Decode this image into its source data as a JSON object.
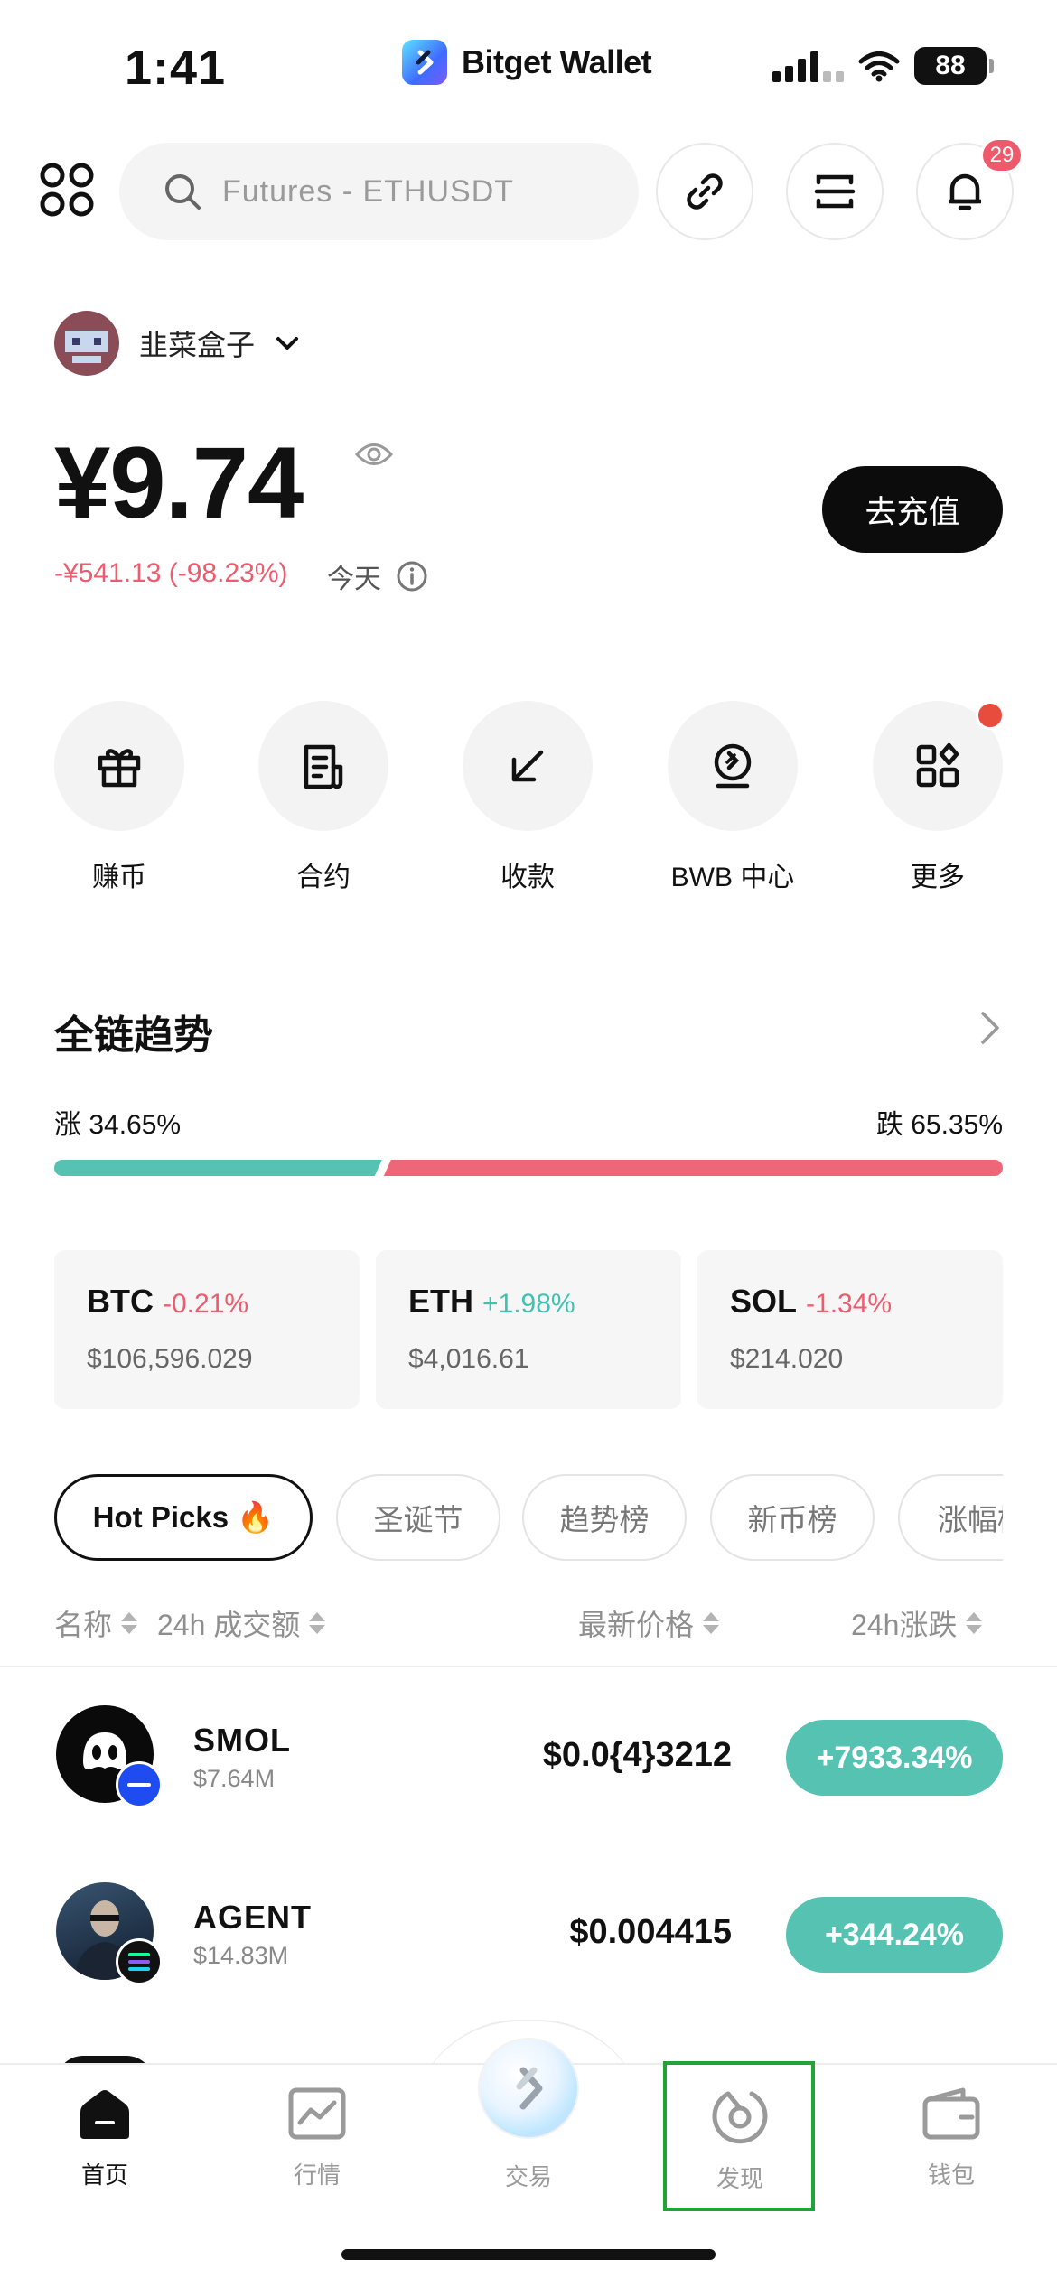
{
  "status_bar": {
    "time": "1:41",
    "app_name": "Bitget Wallet",
    "battery": "88"
  },
  "toolbar": {
    "search_placeholder": "Futures - ETHUSDT",
    "notification_count": "29"
  },
  "account": {
    "name": "韭菜盒子",
    "balance": "¥9.74",
    "change": "-¥541.13 (-98.23%)",
    "period": "今天",
    "deposit_label": "去充值"
  },
  "quick_actions": [
    {
      "label": "赚币",
      "icon": "gift-icon"
    },
    {
      "label": "合约",
      "icon": "contract-icon"
    },
    {
      "label": "收款",
      "icon": "receive-arrow-icon"
    },
    {
      "label": "BWB 中心",
      "icon": "bwb-coin-icon"
    },
    {
      "label": "更多",
      "icon": "more-apps-icon"
    }
  ],
  "trend": {
    "title": "全链趋势",
    "rise_label": "涨 34.65%",
    "fall_label": "跌 65.35%",
    "rise_fraction": 0.3465,
    "colors": {
      "rise": "#55c2b2",
      "fall": "#ee6778"
    }
  },
  "coins": [
    {
      "symbol": "BTC",
      "change": "-0.21%",
      "price": "$106,596.029",
      "direction": "down"
    },
    {
      "symbol": "ETH",
      "change": "+1.98%",
      "price": "$4,016.61",
      "direction": "up"
    },
    {
      "symbol": "SOL",
      "change": "-1.34%",
      "price": "$214.020",
      "direction": "down"
    }
  ],
  "tags": [
    "Hot Picks 🔥",
    "圣诞节",
    "趋势榜",
    "新币榜",
    "涨幅榜"
  ],
  "table_header": {
    "name": "名称",
    "volume": "24h 成交额",
    "price": "最新价格",
    "change": "24h涨跌"
  },
  "rows": [
    {
      "symbol": "SMOL",
      "volume": "$7.64M",
      "price": "$0.0{4}3212",
      "change": "+7933.34%"
    },
    {
      "symbol": "AGENT",
      "volume": "$14.83M",
      "price": "$0.004415",
      "change": "+344.24%"
    }
  ],
  "tabbar": {
    "home": "首页",
    "market": "行情",
    "trade": "交易",
    "discover": "发现",
    "wallet": "钱包"
  },
  "accent_colors": {
    "up": "#41c2b0",
    "down": "#ec5b6e",
    "highlight": "#22a33a"
  }
}
